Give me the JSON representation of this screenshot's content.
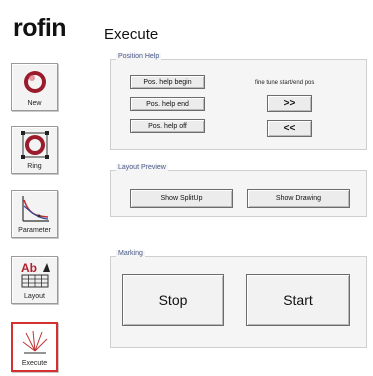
{
  "sidebar": {
    "logo": "rofin",
    "items": [
      {
        "label": "New"
      },
      {
        "label": "Ring"
      },
      {
        "label": "Parameter"
      },
      {
        "label": "Layout"
      },
      {
        "label": "Execute",
        "active": true
      }
    ]
  },
  "main": {
    "title": "Execute",
    "position_help": {
      "title": "Position Help",
      "begin_label": "Pos. help begin",
      "end_label": "Pos. help end",
      "off_label": "Pos. help off",
      "fine_tune_label": "fine tune start/end pos",
      "forward_label": ">>",
      "back_label": "<<"
    },
    "layout_preview": {
      "title": "Layout Preview",
      "split_label": "Show SplitUp",
      "drawing_label": "Show Drawing"
    },
    "marking": {
      "title": "Marking",
      "stop_label": "Stop",
      "start_label": "Start"
    }
  },
  "colors": {
    "active_border": "#d43030",
    "group_title": "#4a5a8a",
    "group_bg": "#f5f5f5"
  },
  "icons": [
    "ring-new-icon",
    "ring-selection-icon",
    "parameter-curve-icon",
    "layout-text-icon",
    "laser-execute-icon"
  ]
}
